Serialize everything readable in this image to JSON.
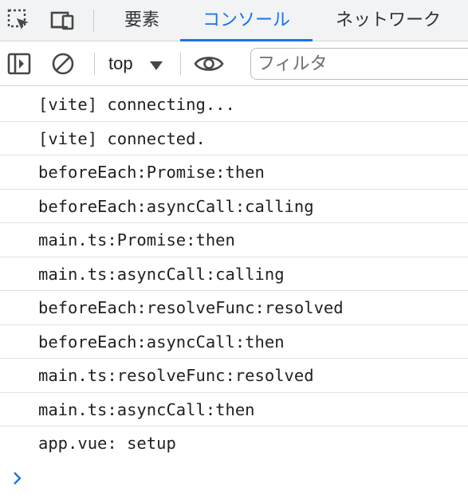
{
  "tabs": [
    {
      "label": "要素"
    },
    {
      "label": "コンソール"
    },
    {
      "label": "ネットワーク"
    }
  ],
  "active_tab": "コンソール",
  "toolbar": {
    "context": "top",
    "filter_placeholder": "フィルタ"
  },
  "icons": {
    "inspect": "inspect-element-icon",
    "device": "device-toolbar-icon",
    "sidebar": "toggle-sidebar-icon",
    "clear": "clear-console-icon",
    "dropdown": "chevron-down-icon",
    "live_expression": "eye-icon",
    "prompt": "chevron-right-icon"
  },
  "colors": {
    "accent": "#1a73e8",
    "tabbar_bg": "#f1f3f4",
    "row_divider": "#e0e2e5",
    "prompt": "#1a73e8"
  },
  "console": {
    "messages": [
      {
        "text": "[vite] connecting..."
      },
      {
        "text": "[vite] connected."
      },
      {
        "text": "beforeEach:Promise:then"
      },
      {
        "text": "beforeEach:asyncCall:calling"
      },
      {
        "text": "main.ts:Promise:then"
      },
      {
        "text": "main.ts:asyncCall:calling"
      },
      {
        "text": "beforeEach:resolveFunc:resolved"
      },
      {
        "text": "beforeEach:asyncCall:then"
      },
      {
        "text": "main.ts:resolveFunc:resolved"
      },
      {
        "text": "main.ts:asyncCall:then"
      },
      {
        "text": "app.vue: setup"
      }
    ]
  }
}
